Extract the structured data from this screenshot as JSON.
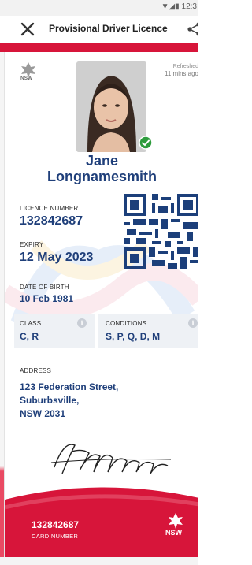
{
  "status_bar": {
    "icons": "▼◢▮",
    "time": "12:3"
  },
  "header": {
    "title": "Provisional Driver Licence",
    "close_icon": "close-icon",
    "share_icon": "share-icon"
  },
  "card": {
    "issuer_logo_text": "NSW",
    "refreshed": {
      "label": "Refreshed",
      "time": "11 mins ago"
    },
    "holder": {
      "first_name": "Jane",
      "last_name": "Longnamesmith"
    },
    "licence_number": {
      "label": "LICENCE NUMBER",
      "value": "132842687"
    },
    "expiry": {
      "label": "EXPIRY",
      "value": "12 May 2023"
    },
    "date_of_birth": {
      "label": "DATE OF BIRTH",
      "value": "10 Feb 1981"
    },
    "class": {
      "label": "CLASS",
      "value": "C, R"
    },
    "conditions": {
      "label": "CONDITIONS",
      "value": "S, P, Q, D, M"
    },
    "address": {
      "label": "ADDRESS",
      "lines": [
        "123 Federation Street,",
        "Suburbsville,",
        "NSW 2031"
      ]
    },
    "card_number": {
      "value": "132842687",
      "label": "CARD NUMBER"
    },
    "footer_logo_text": "NSW"
  },
  "colors": {
    "brand_red": "#d7153a",
    "text_navy": "#1f3f7a",
    "verified_green": "#2e9c3d"
  }
}
